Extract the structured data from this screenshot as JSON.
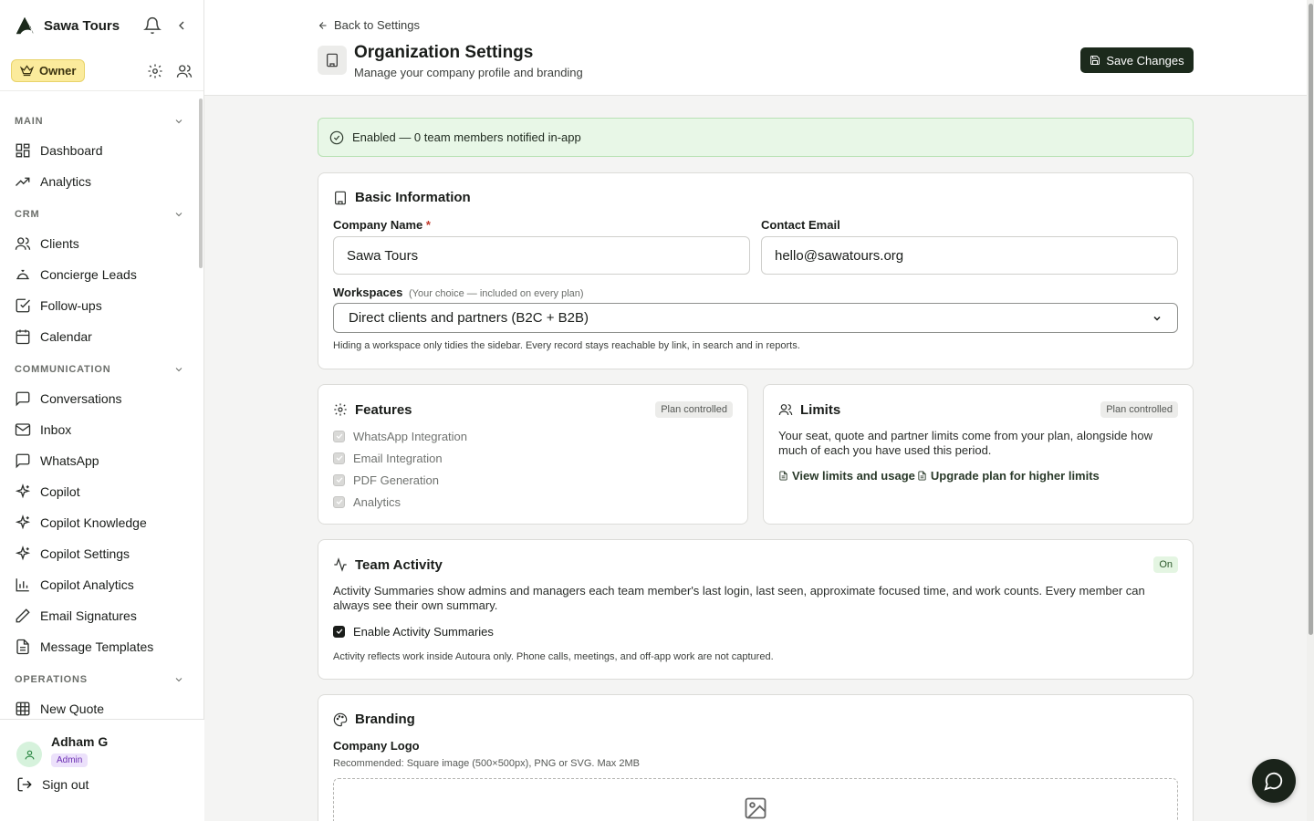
{
  "brand": {
    "name": "Sawa Tours"
  },
  "role": {
    "label": "Owner"
  },
  "sidebar": {
    "sections": [
      {
        "title": "MAIN",
        "items": [
          {
            "label": "Dashboard"
          },
          {
            "label": "Analytics"
          }
        ]
      },
      {
        "title": "CRM",
        "items": [
          {
            "label": "Clients"
          },
          {
            "label": "Concierge Leads"
          },
          {
            "label": "Follow-ups"
          },
          {
            "label": "Calendar"
          }
        ]
      },
      {
        "title": "COMMUNICATION",
        "items": [
          {
            "label": "Conversations"
          },
          {
            "label": "Inbox"
          },
          {
            "label": "WhatsApp"
          },
          {
            "label": "Copilot"
          },
          {
            "label": "Copilot Knowledge"
          },
          {
            "label": "Copilot Settings"
          },
          {
            "label": "Copilot Analytics"
          },
          {
            "label": "Email Signatures"
          },
          {
            "label": "Message Templates"
          }
        ]
      },
      {
        "title": "OPERATIONS",
        "items": [
          {
            "label": "New Quote"
          }
        ]
      }
    ]
  },
  "user": {
    "name": "Adham G",
    "role": "Admin",
    "signout": "Sign out"
  },
  "header": {
    "back": "Back to Settings",
    "title": "Organization Settings",
    "subtitle": "Manage your company profile and branding",
    "save": "Save Changes"
  },
  "banner": {
    "text": "Enabled — 0 team members notified in-app"
  },
  "basic": {
    "title": "Basic Information",
    "company_label": "Company Name",
    "required_mark": "*",
    "company_value": "Sawa Tours",
    "email_label": "Contact Email",
    "email_value": "hello@sawatours.org",
    "workspaces_label": "Workspaces",
    "workspaces_hint": "(Your choice — included on every plan)",
    "workspaces_value": "Direct clients and partners (B2C + B2B)",
    "workspaces_help": "Hiding a workspace only tidies the sidebar. Every record stays reachable by link, in search and in reports."
  },
  "features": {
    "title": "Features",
    "badge": "Plan controlled",
    "items": [
      {
        "label": "WhatsApp Integration"
      },
      {
        "label": "Email Integration"
      },
      {
        "label": "PDF Generation"
      },
      {
        "label": "Analytics"
      }
    ]
  },
  "limits": {
    "title": "Limits",
    "badge": "Plan controlled",
    "text": "Your seat, quote and partner limits come from your plan, alongside how much of each you have used this period.",
    "link1": "View limits and usage",
    "link2": "Upgrade plan for higher limits"
  },
  "team": {
    "title": "Team Activity",
    "badge": "On",
    "text": "Activity Summaries show admins and managers each team member's last login, last seen, approximate focused time, and work counts. Every member can always see their own summary.",
    "checkbox": "Enable Activity Summaries",
    "checked": true,
    "footnote": "Activity reflects work inside Autoura only. Phone calls, meetings, and off-app work are not captured."
  },
  "branding": {
    "title": "Branding",
    "logo_label": "Company Logo",
    "logo_hint": "Recommended: Square image (500×500px), PNG or SVG. Max 2MB"
  },
  "colors": {
    "primary": "#1c2a1c",
    "owner_badge": "#fbeb9c",
    "banner_bg": "#e8f7e7",
    "admin_badge": "#ece1fb"
  }
}
